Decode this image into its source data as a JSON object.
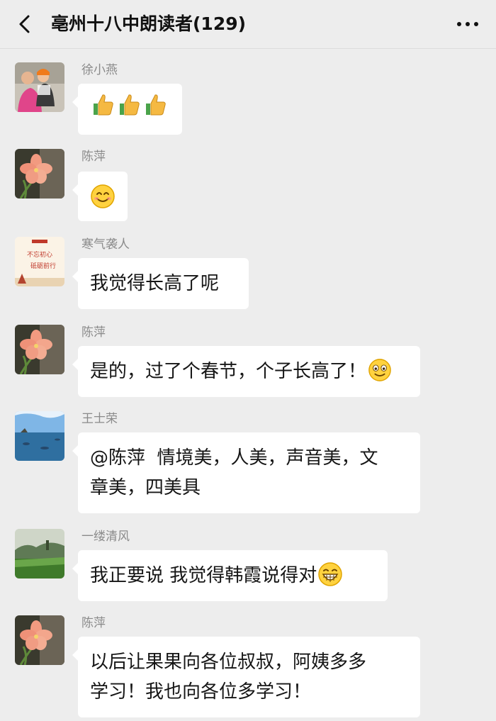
{
  "header": {
    "title": "亳州十八中朗读者(129)",
    "back_icon": "chevron-left-icon",
    "more_icon": "more-dots-icon"
  },
  "messages": [
    {
      "sender": "徐小燕",
      "avatar": "avatar-photo-mother-child",
      "text": "",
      "emojis": [
        "thumbs-up",
        "thumbs-up",
        "thumbs-up"
      ]
    },
    {
      "sender": "陈萍",
      "avatar": "avatar-pink-flower",
      "text": "",
      "emojis": [
        "smile"
      ]
    },
    {
      "sender": "寒气袭人",
      "avatar": "avatar-poster",
      "avatar_text": "不忘初心 砥砺前行",
      "text": "我觉得长高了呢",
      "emojis": []
    },
    {
      "sender": "陈萍",
      "avatar": "avatar-pink-flower",
      "text": "是的，过了个春节，个子长高了！",
      "emojis": [
        "grin"
      ]
    },
    {
      "sender": "王士荣",
      "avatar": "avatar-seascape",
      "text_lines": [
        "@陈萍  情境美，人美，声音美，文",
        "章美，四美具"
      ],
      "emojis": []
    },
    {
      "sender": "一缕清风",
      "avatar": "avatar-green-hills",
      "text": "我正要说 我觉得韩霞说得对",
      "emojis": [
        "big-grin"
      ]
    },
    {
      "sender": "陈萍",
      "avatar": "avatar-pink-flower",
      "text_lines": [
        "以后让果果向各位叔叔，阿姨多多",
        "学习！我也向各位多学习！"
      ],
      "emojis": []
    }
  ],
  "colors": {
    "background": "#ededed",
    "bubble": "#ffffff",
    "sender_name": "#8a8a8a",
    "text": "#161616"
  }
}
